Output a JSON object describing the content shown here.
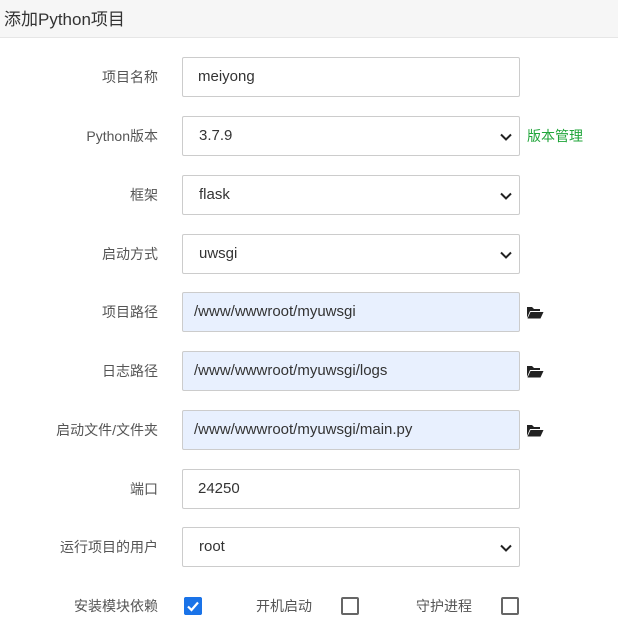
{
  "dialog": {
    "title": "添加Python项目"
  },
  "form": {
    "project_name": {
      "label": "项目名称",
      "value": "meiyong"
    },
    "python_version": {
      "label": "Python版本",
      "value": "3.7.9",
      "link": "版本管理"
    },
    "framework": {
      "label": "框架",
      "value": "flask"
    },
    "start_method": {
      "label": "启动方式",
      "value": "uwsgi"
    },
    "project_path": {
      "label": "项目路径",
      "value": "/www/wwwroot/myuwsgi"
    },
    "log_path": {
      "label": "日志路径",
      "value": "/www/wwwroot/myuwsgi/logs"
    },
    "startup_file": {
      "label": "启动文件/文件夹",
      "value": "/www/wwwroot/myuwsgi/main.py"
    },
    "port": {
      "label": "端口",
      "value": "24250"
    },
    "run_user": {
      "label": "运行项目的用户",
      "value": "root"
    },
    "install_deps": {
      "label": "安装模块依赖",
      "checked": true
    },
    "autostart": {
      "label": "开机启动",
      "checked": false
    },
    "daemon": {
      "label": "守护进程",
      "checked": false
    }
  },
  "colors": {
    "link": "#20a53a",
    "path_bg": "#e8f0fe",
    "checkbox_on": "#1a73e8"
  }
}
